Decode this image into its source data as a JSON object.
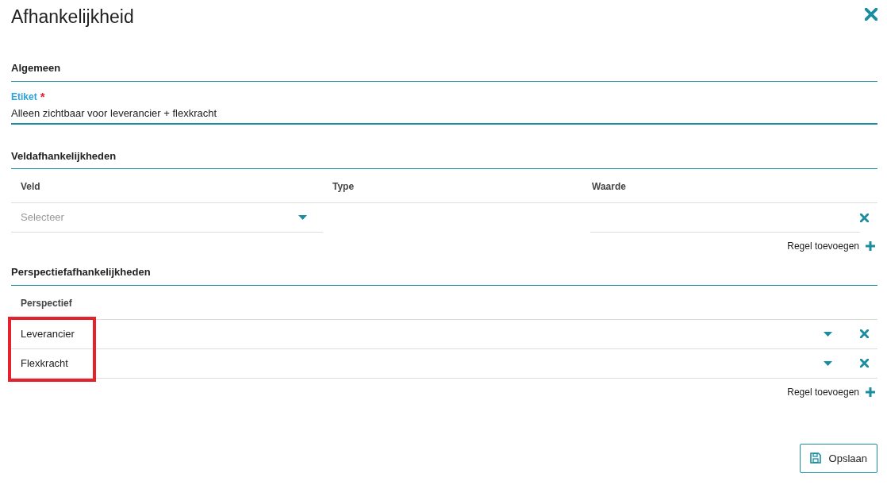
{
  "window": {
    "title": "Afhankelijkheid"
  },
  "sections": [
    {
      "title": "Algemeen"
    },
    {
      "title": "Veldafhankelijkheden"
    },
    {
      "title": "Perspectiefafhankelijkheden"
    }
  ],
  "general": {
    "label": "Etiket",
    "required_marker": "*",
    "value": "Alleen zichtbaar voor leverancier + flexkracht"
  },
  "field_dependencies": {
    "columns": [
      "Veld",
      "Type",
      "Waarde"
    ],
    "rows": [
      {
        "placeholder": "Selecteer"
      }
    ],
    "add_label": "Regel toevoegen"
  },
  "perspective_dependencies": {
    "columns": [
      "Perspectief"
    ],
    "rows": [
      {
        "value": "Leverancier",
        "highlighted": true
      },
      {
        "value": "Flexkracht",
        "highlighted": true
      }
    ],
    "add_label": "Regel toevoegen"
  },
  "save_button": "Opslaan"
}
